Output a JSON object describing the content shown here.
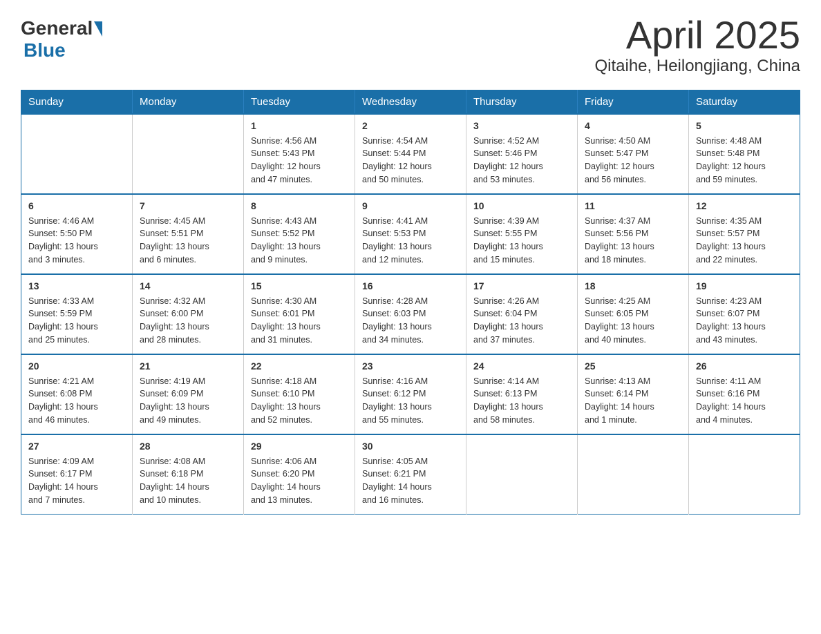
{
  "header": {
    "logo_general": "General",
    "logo_blue": "Blue",
    "title": "April 2025",
    "subtitle": "Qitaihe, Heilongjiang, China"
  },
  "weekdays": [
    "Sunday",
    "Monday",
    "Tuesday",
    "Wednesday",
    "Thursday",
    "Friday",
    "Saturday"
  ],
  "weeks": [
    [
      {
        "day": "",
        "info": []
      },
      {
        "day": "",
        "info": []
      },
      {
        "day": "1",
        "info": [
          "Sunrise: 4:56 AM",
          "Sunset: 5:43 PM",
          "Daylight: 12 hours",
          "and 47 minutes."
        ]
      },
      {
        "day": "2",
        "info": [
          "Sunrise: 4:54 AM",
          "Sunset: 5:44 PM",
          "Daylight: 12 hours",
          "and 50 minutes."
        ]
      },
      {
        "day": "3",
        "info": [
          "Sunrise: 4:52 AM",
          "Sunset: 5:46 PM",
          "Daylight: 12 hours",
          "and 53 minutes."
        ]
      },
      {
        "day": "4",
        "info": [
          "Sunrise: 4:50 AM",
          "Sunset: 5:47 PM",
          "Daylight: 12 hours",
          "and 56 minutes."
        ]
      },
      {
        "day": "5",
        "info": [
          "Sunrise: 4:48 AM",
          "Sunset: 5:48 PM",
          "Daylight: 12 hours",
          "and 59 minutes."
        ]
      }
    ],
    [
      {
        "day": "6",
        "info": [
          "Sunrise: 4:46 AM",
          "Sunset: 5:50 PM",
          "Daylight: 13 hours",
          "and 3 minutes."
        ]
      },
      {
        "day": "7",
        "info": [
          "Sunrise: 4:45 AM",
          "Sunset: 5:51 PM",
          "Daylight: 13 hours",
          "and 6 minutes."
        ]
      },
      {
        "day": "8",
        "info": [
          "Sunrise: 4:43 AM",
          "Sunset: 5:52 PM",
          "Daylight: 13 hours",
          "and 9 minutes."
        ]
      },
      {
        "day": "9",
        "info": [
          "Sunrise: 4:41 AM",
          "Sunset: 5:53 PM",
          "Daylight: 13 hours",
          "and 12 minutes."
        ]
      },
      {
        "day": "10",
        "info": [
          "Sunrise: 4:39 AM",
          "Sunset: 5:55 PM",
          "Daylight: 13 hours",
          "and 15 minutes."
        ]
      },
      {
        "day": "11",
        "info": [
          "Sunrise: 4:37 AM",
          "Sunset: 5:56 PM",
          "Daylight: 13 hours",
          "and 18 minutes."
        ]
      },
      {
        "day": "12",
        "info": [
          "Sunrise: 4:35 AM",
          "Sunset: 5:57 PM",
          "Daylight: 13 hours",
          "and 22 minutes."
        ]
      }
    ],
    [
      {
        "day": "13",
        "info": [
          "Sunrise: 4:33 AM",
          "Sunset: 5:59 PM",
          "Daylight: 13 hours",
          "and 25 minutes."
        ]
      },
      {
        "day": "14",
        "info": [
          "Sunrise: 4:32 AM",
          "Sunset: 6:00 PM",
          "Daylight: 13 hours",
          "and 28 minutes."
        ]
      },
      {
        "day": "15",
        "info": [
          "Sunrise: 4:30 AM",
          "Sunset: 6:01 PM",
          "Daylight: 13 hours",
          "and 31 minutes."
        ]
      },
      {
        "day": "16",
        "info": [
          "Sunrise: 4:28 AM",
          "Sunset: 6:03 PM",
          "Daylight: 13 hours",
          "and 34 minutes."
        ]
      },
      {
        "day": "17",
        "info": [
          "Sunrise: 4:26 AM",
          "Sunset: 6:04 PM",
          "Daylight: 13 hours",
          "and 37 minutes."
        ]
      },
      {
        "day": "18",
        "info": [
          "Sunrise: 4:25 AM",
          "Sunset: 6:05 PM",
          "Daylight: 13 hours",
          "and 40 minutes."
        ]
      },
      {
        "day": "19",
        "info": [
          "Sunrise: 4:23 AM",
          "Sunset: 6:07 PM",
          "Daylight: 13 hours",
          "and 43 minutes."
        ]
      }
    ],
    [
      {
        "day": "20",
        "info": [
          "Sunrise: 4:21 AM",
          "Sunset: 6:08 PM",
          "Daylight: 13 hours",
          "and 46 minutes."
        ]
      },
      {
        "day": "21",
        "info": [
          "Sunrise: 4:19 AM",
          "Sunset: 6:09 PM",
          "Daylight: 13 hours",
          "and 49 minutes."
        ]
      },
      {
        "day": "22",
        "info": [
          "Sunrise: 4:18 AM",
          "Sunset: 6:10 PM",
          "Daylight: 13 hours",
          "and 52 minutes."
        ]
      },
      {
        "day": "23",
        "info": [
          "Sunrise: 4:16 AM",
          "Sunset: 6:12 PM",
          "Daylight: 13 hours",
          "and 55 minutes."
        ]
      },
      {
        "day": "24",
        "info": [
          "Sunrise: 4:14 AM",
          "Sunset: 6:13 PM",
          "Daylight: 13 hours",
          "and 58 minutes."
        ]
      },
      {
        "day": "25",
        "info": [
          "Sunrise: 4:13 AM",
          "Sunset: 6:14 PM",
          "Daylight: 14 hours",
          "and 1 minute."
        ]
      },
      {
        "day": "26",
        "info": [
          "Sunrise: 4:11 AM",
          "Sunset: 6:16 PM",
          "Daylight: 14 hours",
          "and 4 minutes."
        ]
      }
    ],
    [
      {
        "day": "27",
        "info": [
          "Sunrise: 4:09 AM",
          "Sunset: 6:17 PM",
          "Daylight: 14 hours",
          "and 7 minutes."
        ]
      },
      {
        "day": "28",
        "info": [
          "Sunrise: 4:08 AM",
          "Sunset: 6:18 PM",
          "Daylight: 14 hours",
          "and 10 minutes."
        ]
      },
      {
        "day": "29",
        "info": [
          "Sunrise: 4:06 AM",
          "Sunset: 6:20 PM",
          "Daylight: 14 hours",
          "and 13 minutes."
        ]
      },
      {
        "day": "30",
        "info": [
          "Sunrise: 4:05 AM",
          "Sunset: 6:21 PM",
          "Daylight: 14 hours",
          "and 16 minutes."
        ]
      },
      {
        "day": "",
        "info": []
      },
      {
        "day": "",
        "info": []
      },
      {
        "day": "",
        "info": []
      }
    ]
  ]
}
